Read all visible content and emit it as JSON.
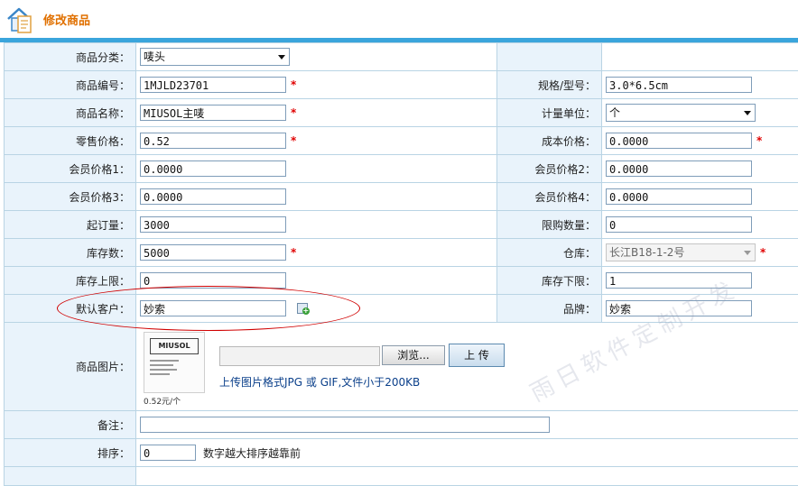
{
  "header": {
    "title": "修改商品",
    "icon": "house-doc-icon"
  },
  "fields": {
    "category": {
      "label": "商品分类：",
      "value": "唛头"
    },
    "code": {
      "label": "商品编号：",
      "value": "1MJLD23701",
      "required": "*"
    },
    "spec": {
      "label": "规格/型号：",
      "value": "3.0*6.5cm"
    },
    "name": {
      "label": "商品名称：",
      "value": "MIUSOL主唛",
      "required": "*"
    },
    "unit": {
      "label": "计量单位：",
      "value": "个"
    },
    "retail_price": {
      "label": "零售价格：",
      "value": "0.52",
      "required": "*"
    },
    "cost_price": {
      "label": "成本价格：",
      "value": "0.0000",
      "required": "*"
    },
    "member_price1": {
      "label": "会员价格1：",
      "value": "0.0000"
    },
    "member_price2": {
      "label": "会员价格2：",
      "value": "0.0000"
    },
    "member_price3": {
      "label": "会员价格3：",
      "value": "0.0000"
    },
    "member_price4": {
      "label": "会员价格4：",
      "value": "0.0000"
    },
    "min_order": {
      "label": "起订量：",
      "value": "3000"
    },
    "purchase_limit": {
      "label": "限购数量：",
      "value": "0"
    },
    "stock": {
      "label": "库存数：",
      "value": "5000",
      "required": "*"
    },
    "warehouse": {
      "label": "仓库：",
      "value": "长江B18-1-2号",
      "required": "*"
    },
    "stock_max": {
      "label": "库存上限：",
      "value": "0"
    },
    "stock_min": {
      "label": "库存下限：",
      "value": "1"
    },
    "default_customer": {
      "label": "默认客户：",
      "value": "妙索"
    },
    "brand": {
      "label": "品牌：",
      "value": "妙索"
    },
    "image": {
      "label": "商品图片：",
      "thumb_brand": "MIUSOL",
      "thumb_price": "0.52元/个",
      "browse_label": "浏览...",
      "upload_label": "上 传",
      "hint": "上传图片格式JPG 或 GIF,文件小于200KB"
    },
    "remark": {
      "label": "备注：",
      "value": ""
    },
    "sort": {
      "label": "排序：",
      "value": "0",
      "hint": "数字越大排序越靠前"
    }
  },
  "watermark": "雨日软件定制开发",
  "colors": {
    "accent": "#e07000",
    "bar": "#3aa5dc",
    "label_bg": "#e9f3fb",
    "border": "#b9d4e4",
    "required": "#e00000",
    "annotation": "#d00000"
  }
}
